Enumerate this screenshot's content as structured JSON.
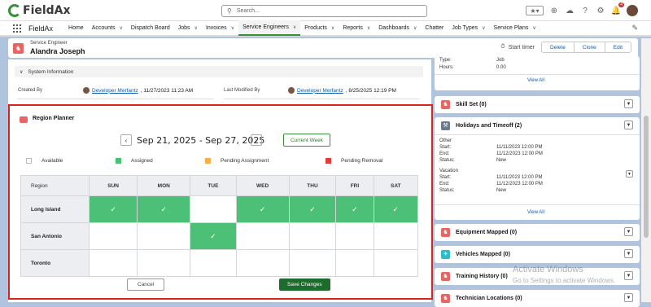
{
  "app": {
    "logo_text": "FieldAx",
    "name": "FieldAx"
  },
  "search": {
    "placeholder": "Search..."
  },
  "topbar": {
    "notification_count": "4"
  },
  "nav": {
    "items": [
      {
        "label": "Home",
        "chevron": false
      },
      {
        "label": "Accounts",
        "chevron": true
      },
      {
        "label": "Dispatch Board",
        "chevron": false
      },
      {
        "label": "Jobs",
        "chevron": true
      },
      {
        "label": "Invoices",
        "chevron": true
      },
      {
        "label": "Service Engineers",
        "chevron": true,
        "active": true
      },
      {
        "label": "Products",
        "chevron": true
      },
      {
        "label": "Reports",
        "chevron": true
      },
      {
        "label": "Dashboards",
        "chevron": true
      },
      {
        "label": "Chatter",
        "chevron": false
      },
      {
        "label": "Job Types",
        "chevron": true
      },
      {
        "label": "Service Plans",
        "chevron": true
      }
    ]
  },
  "record": {
    "object_label": "Service Engineer",
    "name": "Alandra Joseph",
    "start_timer": "Start timer",
    "buttons": [
      "Delete",
      "Clone",
      "Edit"
    ]
  },
  "system_info": {
    "title": "System Information",
    "created_by_label": "Created By",
    "created_by": "Developer Merfantz",
    "created_date": ", 11/27/2023 11:23 AM",
    "modified_by_label": "Last Modified By",
    "modified_by": "Developer Merfantz",
    "modified_date": ", 8/25/2025 12:19 PM"
  },
  "region_planner": {
    "title": "Region Planner",
    "date_range": "Sep 21, 2025 - Sep 27, 2025",
    "current_week": "Current Week",
    "legend": [
      {
        "label": "Available",
        "color": "#ffffff"
      },
      {
        "label": "Assigned",
        "color": "#4bc076"
      },
      {
        "label": "Pending Assignment",
        "color": "#f5b04a"
      },
      {
        "label": "Pending Removal",
        "color": "#e23b3b"
      }
    ],
    "region_header": "Region",
    "days": [
      "SUN",
      "MON",
      "TUE",
      "WED",
      "THU",
      "FRI",
      "SAT"
    ],
    "check": "✓",
    "rows": [
      {
        "region": "Long Island",
        "assigned": [
          true,
          true,
          false,
          true,
          true,
          true,
          true
        ]
      },
      {
        "region": "San Antonio",
        "assigned": [
          false,
          false,
          true,
          false,
          false,
          false,
          false
        ]
      },
      {
        "region": "Toronto",
        "assigned": [
          false,
          false,
          false,
          false,
          false,
          false,
          false
        ]
      }
    ],
    "cancel": "Cancel",
    "save": "Save Changes"
  },
  "right": {
    "top_card": {
      "type_label": "Type:",
      "type_value": "Job",
      "hours_label": "Hours:",
      "hours_value": "0.00",
      "view_all": "View All"
    },
    "skill_set": {
      "title": "Skill Set (0)",
      "color": "#e96563"
    },
    "holidays": {
      "title": "Holidays and Timeoff (2)",
      "color": "#6d7a8a",
      "entries": [
        {
          "name": "Other",
          "start_label": "Start:",
          "start": "11/11/2023 12:00 PM",
          "end_label": "End:",
          "end": "11/12/2023 12:00 PM",
          "status_label": "Status:",
          "status": "New"
        },
        {
          "name": "Vacation",
          "start_label": "Start:",
          "start": "11/11/2023 12:00 PM",
          "end_label": "End:",
          "end": "11/12/2023 12:00 PM",
          "status_label": "Status:",
          "status": "New"
        }
      ],
      "view_all": "View All"
    },
    "equipment": {
      "title": "Equipment Mapped (0)",
      "color": "#e96563"
    },
    "vehicles": {
      "title": "Vehicles Mapped (0)",
      "color": "#30b9c9"
    },
    "training": {
      "title": "Training History (0)",
      "color": "#e96563"
    },
    "technician": {
      "title": "Technician Locations (0)",
      "color": "#e96563"
    }
  },
  "watermark": {
    "line1": "Activate Windows",
    "line2": "Go to Settings to activate Windows."
  }
}
